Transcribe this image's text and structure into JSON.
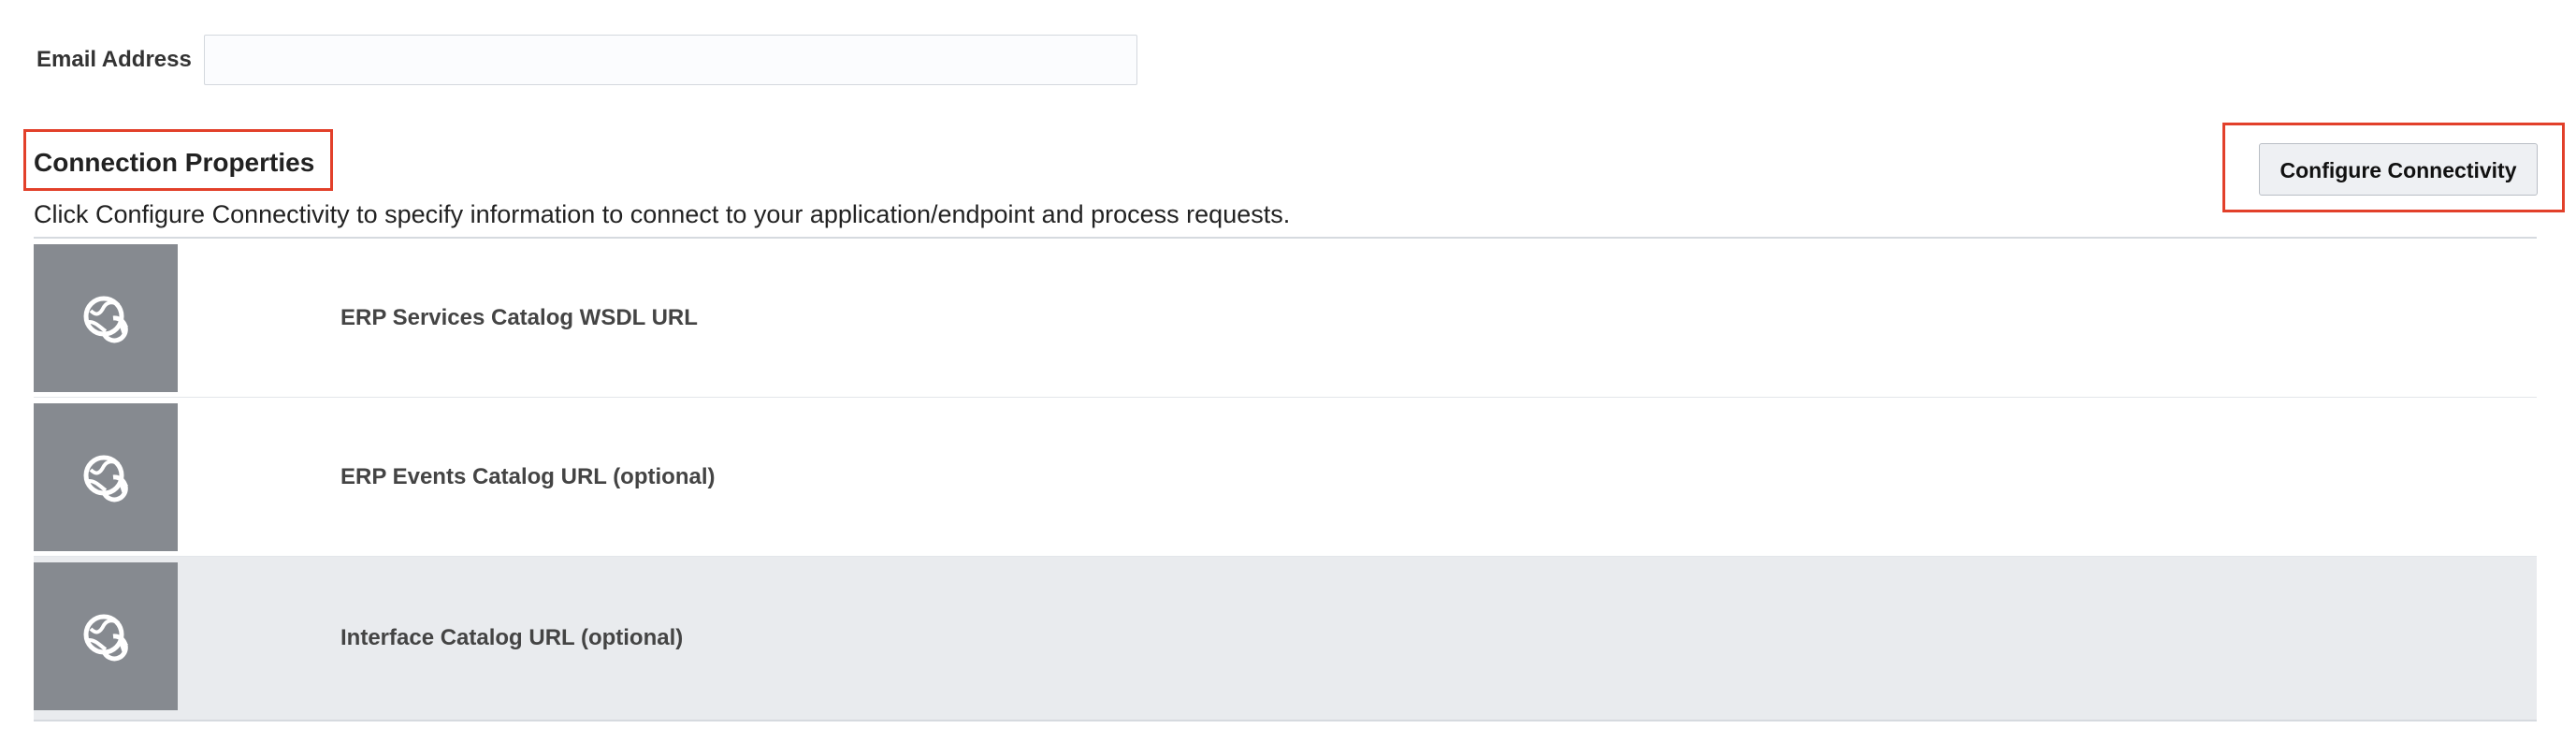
{
  "email": {
    "label": "Email Address",
    "value": "",
    "placeholder": ""
  },
  "connection": {
    "title": "Connection Properties",
    "description": "Click Configure Connectivity to specify information to connect to your application/endpoint and process requests.",
    "configure_label": "Configure Connectivity"
  },
  "properties": [
    {
      "label": "ERP Services Catalog WSDL URL",
      "icon": "globe-refresh-icon"
    },
    {
      "label": "ERP Events Catalog URL (optional)",
      "icon": "globe-refresh-icon"
    },
    {
      "label": "Interface Catalog URL (optional)",
      "icon": "globe-refresh-icon"
    }
  ],
  "colors": {
    "highlight": "#e2402a",
    "icon_box": "#868a90",
    "selected_row": "#e9ebee"
  }
}
